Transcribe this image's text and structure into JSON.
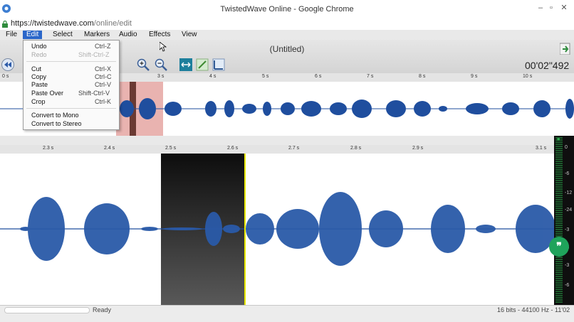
{
  "browser": {
    "window_title": "TwistedWave Online - Google Chrome",
    "url_host": "https://twistedwave.com",
    "url_path": "/online/edit"
  },
  "menubar": {
    "items": [
      {
        "label": "File"
      },
      {
        "label": "Edit"
      },
      {
        "label": "Select"
      },
      {
        "label": "Markers"
      },
      {
        "label": "Audio"
      },
      {
        "label": "Effects"
      },
      {
        "label": "View"
      }
    ],
    "active": "Edit"
  },
  "edit_menu": {
    "items": [
      {
        "label": "Undo",
        "shortcut": "Ctrl-Z",
        "enabled": true
      },
      {
        "label": "Redo",
        "shortcut": "Shift-Ctrl-Z",
        "enabled": false
      },
      {
        "label": "Cut",
        "shortcut": "Ctrl-X",
        "enabled": true
      },
      {
        "label": "Copy",
        "shortcut": "Ctrl-C",
        "enabled": true
      },
      {
        "label": "Paste",
        "shortcut": "Ctrl-V",
        "enabled": true
      },
      {
        "label": "Paste Over",
        "shortcut": "Shift-Ctrl-V",
        "enabled": true
      },
      {
        "label": "Crop",
        "shortcut": "Ctrl-K",
        "enabled": true
      },
      {
        "label": "Convert to Mono",
        "shortcut": "",
        "enabled": true
      },
      {
        "label": "Convert to Stereo",
        "shortcut": "",
        "enabled": true
      }
    ]
  },
  "editor": {
    "document_title": "(Untitled)",
    "time_display": "00'02\"492",
    "status": "Ready",
    "format": "16 bits - 44100 Hz - 11'02"
  },
  "overview_ruler": {
    "ticks": [
      "0 s",
      "3 s",
      "4 s",
      "5 s",
      "6 s",
      "7 s",
      "8 s",
      "9 s",
      "10 s"
    ]
  },
  "main_ruler": {
    "ticks": [
      "2.3 s",
      "2.4 s",
      "2.5 s",
      "2.6 s",
      "2.7 s",
      "2.8 s",
      "2.9 s",
      "3.1 s"
    ]
  },
  "level_meter": {
    "labels": [
      "0",
      "-6",
      "-12",
      "-24",
      "-3",
      "-3",
      "-3",
      "-6"
    ]
  },
  "colors": {
    "waveform": "#1f4e9e",
    "selection_overview": "#e9b3b0",
    "menu_highlight": "#2a66c9",
    "playhead": "#e8e800",
    "chat_button": "#1fa35b"
  },
  "chat": {
    "glyph": "❞"
  }
}
